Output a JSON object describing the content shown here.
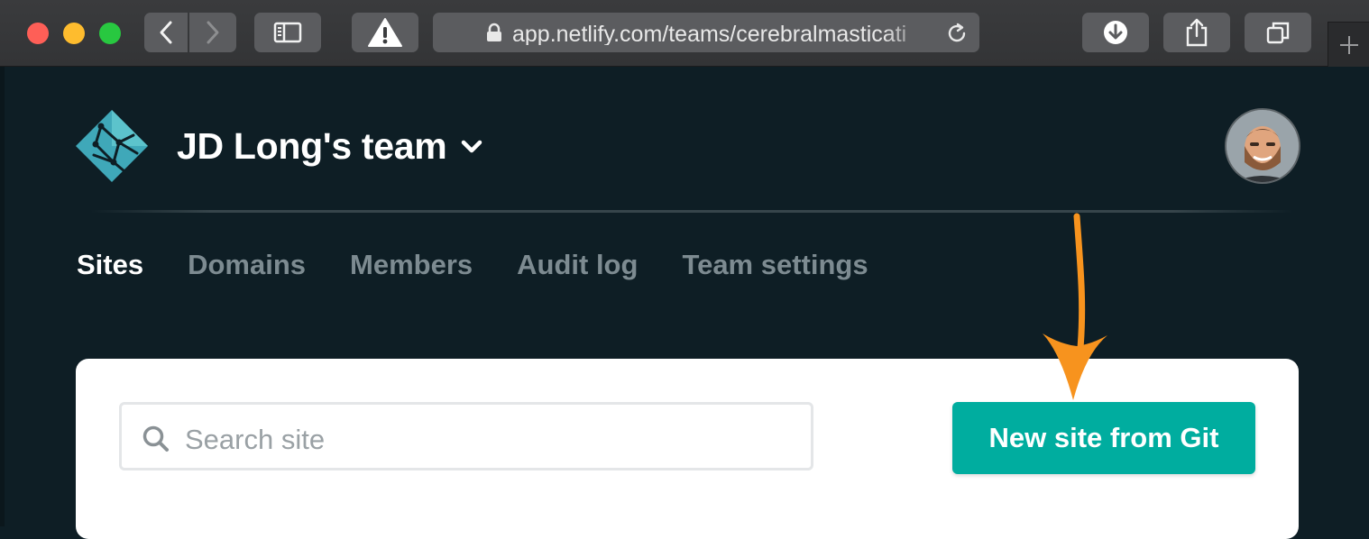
{
  "browser": {
    "url": "app.netlify.com/teams/cerebralmasticati",
    "icons": {
      "back": "chevron-left-icon",
      "forward": "chevron-right-icon",
      "sidebar": "sidebar-icon",
      "warning": "warning-icon",
      "lock": "lock-icon",
      "reload": "reload-icon",
      "download": "download-icon",
      "share": "share-icon",
      "tabs": "tabs-overview-icon",
      "new_tab": "plus-icon"
    }
  },
  "header": {
    "team_name": "JD Long's team",
    "team_menu_icon": "chevron-down-icon",
    "logo_icon": "netlify-logo-icon",
    "avatar_icon": "user-avatar"
  },
  "nav": {
    "tabs": [
      {
        "label": "Sites",
        "active": true
      },
      {
        "label": "Domains",
        "active": false
      },
      {
        "label": "Members",
        "active": false
      },
      {
        "label": "Audit log",
        "active": false
      },
      {
        "label": "Team settings",
        "active": false
      }
    ]
  },
  "sites": {
    "search_placeholder": "Search site",
    "new_site_label": "New site from Git"
  },
  "colors": {
    "page_bg": "#0e1e25",
    "accent": "#00ad9f",
    "tab_active": "#ffffff",
    "tab_inactive": "#7d8b91",
    "annotation_arrow": "#f7931e"
  }
}
